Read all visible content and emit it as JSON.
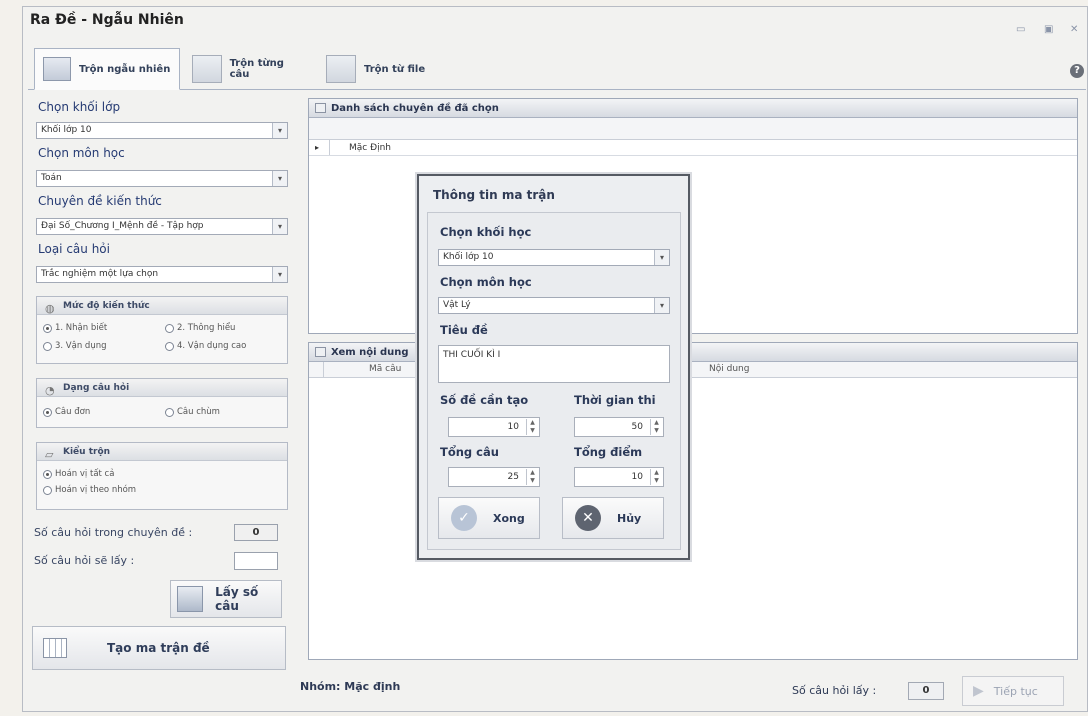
{
  "window": {
    "title": "Ra Đề - Ngẫu Nhiên",
    "min_icon": "▭",
    "max_icon": "▣",
    "close_icon": "✕"
  },
  "tabs": [
    {
      "label": "Trộn ngẫu nhiên",
      "active": true
    },
    {
      "label": "Trộn từng câu",
      "active": false
    },
    {
      "label": "Trộn từ file",
      "active": false
    }
  ],
  "help_icon": "?",
  "left": {
    "grade_label": "Chọn khối lớp",
    "grade_value": "Khối lớp 10",
    "subject_label": "Chọn môn học",
    "subject_value": "Toán",
    "topic_label": "Chuyên đề kiến thức",
    "topic_value": "Đại Số_Chương I_Mệnh đề - Tập hợp",
    "qtype_label": "Loại câu hỏi",
    "qtype_value": "Trắc nghiệm một lựa chọn",
    "level_title": "Mức độ kiến thức",
    "levels": [
      "1. Nhận biết",
      "2. Thông hiểu",
      "3. Vận dụng",
      "4. Vận dụng cao"
    ],
    "form_title": "Dạng câu hỏi",
    "forms": [
      "Câu đơn",
      "Câu chùm"
    ],
    "mix_title": "Kiểu trộn",
    "mixes": [
      "Hoán vị tất cả",
      "Hoán vị theo nhóm"
    ],
    "count_in_topic_label": "Số câu hỏi trong chuyên đề :",
    "count_in_topic_value": "0",
    "count_take_label": "Số câu hỏi sẽ lấy :",
    "count_take_value": "",
    "get_count_button": "Lấy số câu",
    "make_matrix_button": "Tạo ma trận đề"
  },
  "topics_panel": {
    "title": "Danh sách chuyên đề đã chọn",
    "rows": [
      "Mặc Định"
    ]
  },
  "content_panel": {
    "title": "Xem nội dung",
    "col_code": "Mã câu",
    "col_content": "Nội dung"
  },
  "dialog": {
    "title": "Thông tin ma trận",
    "grade_label": "Chọn khối học",
    "grade_value": "Khối lớp 10",
    "subject_label": "Chọn môn học",
    "subject_value": "Vật Lý",
    "heading_label": "Tiêu đề",
    "heading_value": "THI CUỐI KÌ I",
    "num_tests_label": "Số đề cần tạo",
    "num_tests_value": "10",
    "time_label": "Thời gian thi",
    "time_value": "50",
    "total_q_label": "Tổng câu",
    "total_q_value": "25",
    "total_score_label": "Tổng điểm",
    "total_score_value": "10",
    "ok_button": "Xong",
    "cancel_button": "Hủy"
  },
  "footer": {
    "group_label": "Nhóm: Mặc định",
    "taken_label": "Số câu hỏi lấy :",
    "taken_value": "0",
    "next_button": "Tiếp tục"
  }
}
